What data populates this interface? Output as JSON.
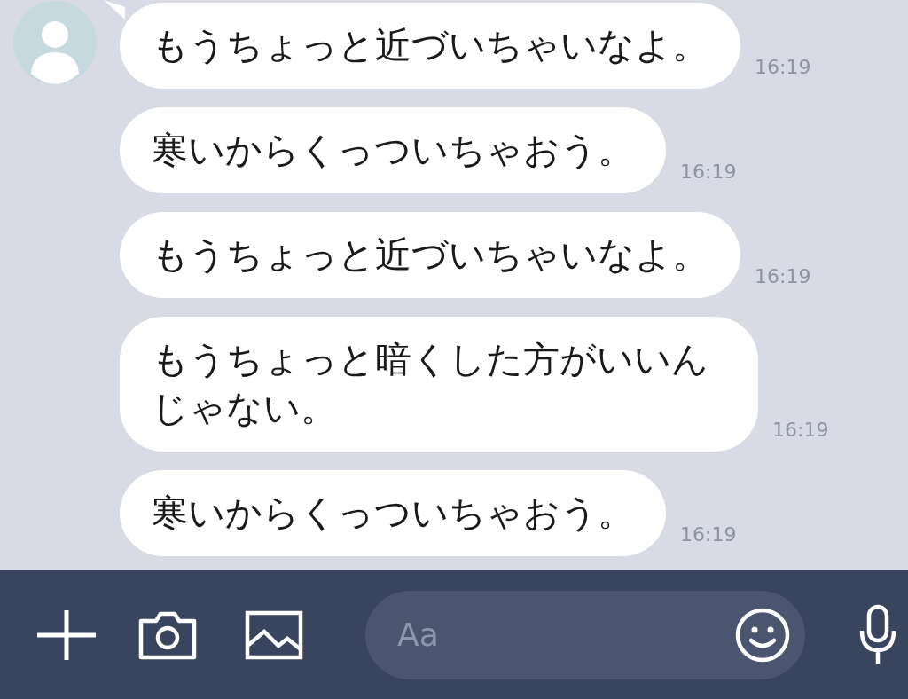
{
  "messages": [
    {
      "text": "もうちょっと近づいちゃいなよ。",
      "time": "16:19",
      "first_in_group": true
    },
    {
      "text": "寒いからくっついちゃおう。",
      "time": "16:19",
      "first_in_group": false
    },
    {
      "text": "もうちょっと近づいちゃいなよ。",
      "time": "16:19",
      "first_in_group": false
    },
    {
      "text": "もうちょっと暗くした方がいいんじゃない。",
      "time": "16:19",
      "first_in_group": false
    },
    {
      "text": "寒いからくっついちゃおう。",
      "time": "16:19",
      "first_in_group": false
    }
  ],
  "input": {
    "placeholder": "Aa"
  }
}
